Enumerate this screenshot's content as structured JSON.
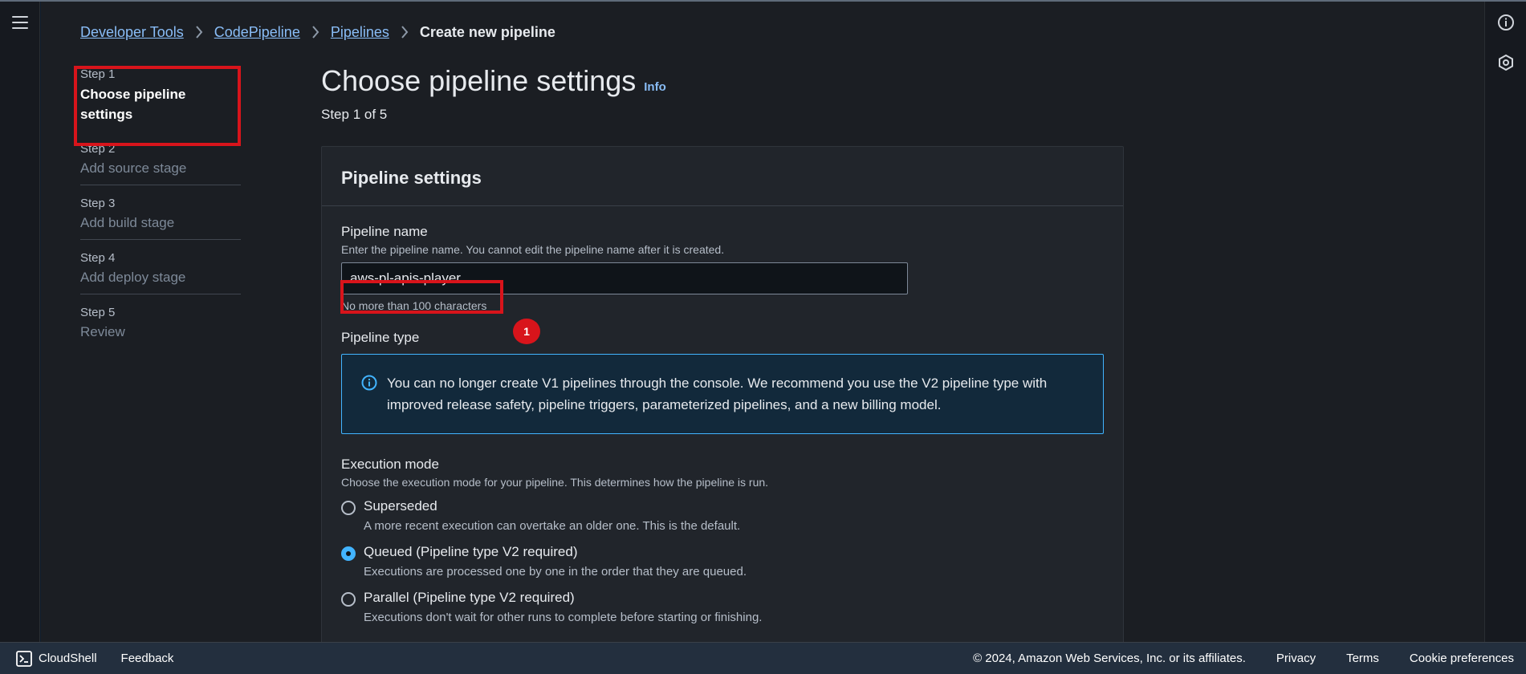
{
  "breadcrumb": {
    "items": [
      "Developer Tools",
      "CodePipeline",
      "Pipelines"
    ],
    "current": "Create new pipeline"
  },
  "steps": [
    {
      "label": "Step 1",
      "title": "Choose pipeline settings"
    },
    {
      "label": "Step 2",
      "title": "Add source stage"
    },
    {
      "label": "Step 3",
      "title": "Add build stage"
    },
    {
      "label": "Step 4",
      "title": "Add deploy stage"
    },
    {
      "label": "Step 5",
      "title": "Review"
    }
  ],
  "header": {
    "title": "Choose pipeline settings",
    "info": "Info",
    "step_of": "Step 1 of 5"
  },
  "panel": {
    "title": "Pipeline settings",
    "pipeline_name": {
      "label": "Pipeline name",
      "description": "Enter the pipeline name. You cannot edit the pipeline name after it is created.",
      "value": "aws-pl-apis-player",
      "constraint": "No more than 100 characters"
    },
    "badge": "1",
    "pipeline_type": {
      "label": "Pipeline type",
      "alert": "You can no longer create V1 pipelines through the console. We recommend you use the V2 pipeline type with improved release safety, pipeline triggers, parameterized pipelines, and a new billing model."
    },
    "execution_mode": {
      "label": "Execution mode",
      "description": "Choose the execution mode for your pipeline. This determines how the pipeline is run.",
      "options": [
        {
          "label": "Superseded",
          "description": "A more recent execution can overtake an older one. This is the default."
        },
        {
          "label": "Queued (Pipeline type V2 required)",
          "description": "Executions are processed one by one in the order that they are queued."
        },
        {
          "label": "Parallel (Pipeline type V2 required)",
          "description": "Executions don't wait for other runs to complete before starting or finishing."
        }
      ],
      "selected": "Queued (Pipeline type V2 required)"
    }
  },
  "footer": {
    "cloudshell": "CloudShell",
    "feedback": "Feedback",
    "copyright": "© 2024, Amazon Web Services, Inc. or its affiliates.",
    "privacy": "Privacy",
    "terms": "Terms",
    "cookies": "Cookie preferences"
  },
  "colors": {
    "accent": "#42b4ff",
    "link": "#89bdf7",
    "highlight": "#d8141b"
  }
}
